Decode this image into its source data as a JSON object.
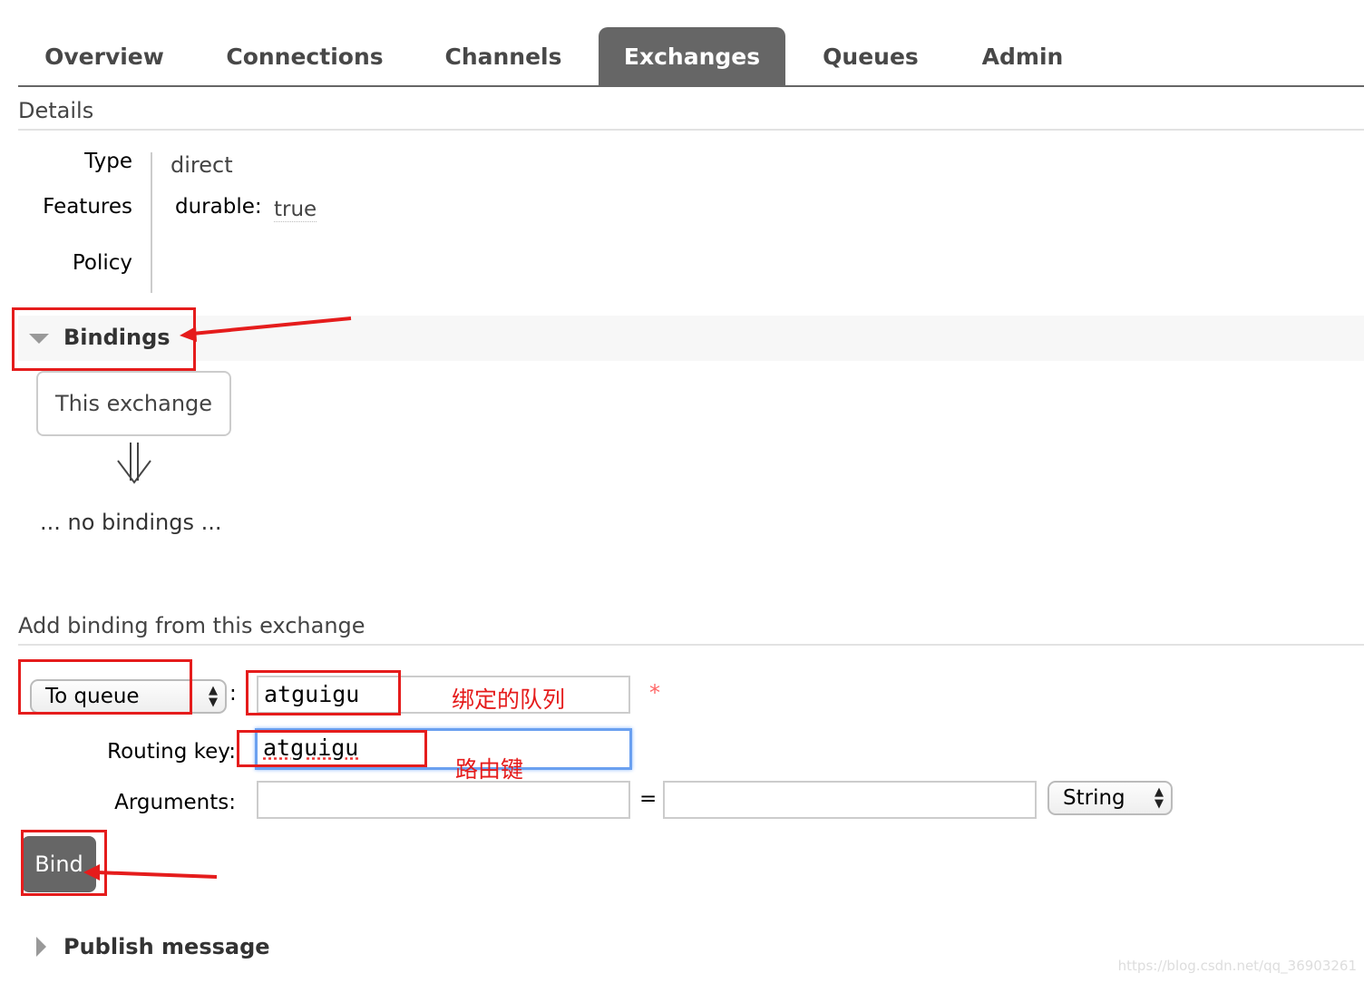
{
  "nav": {
    "tabs": [
      {
        "label": "Overview",
        "active": false
      },
      {
        "label": "Connections",
        "active": false
      },
      {
        "label": "Channels",
        "active": false
      },
      {
        "label": "Exchanges",
        "active": true
      },
      {
        "label": "Queues",
        "active": false
      },
      {
        "label": "Admin",
        "active": false
      }
    ]
  },
  "details": {
    "heading": "Details",
    "type_label": "Type",
    "type_value": "direct",
    "features_label": "Features",
    "durable_label": "durable:",
    "durable_value": "true",
    "policy_label": "Policy"
  },
  "bindings": {
    "heading": "Bindings",
    "this_exchange": "This exchange",
    "arrow_icon": "double-down-arrow",
    "empty_text": "... no bindings ..."
  },
  "add_binding": {
    "heading": "Add binding from this exchange",
    "destination_type": "To queue",
    "colon": ":",
    "destination_value": "atguigu",
    "required_mark": "*",
    "routing_key_label": "Routing key:",
    "routing_key_value": "atguigu",
    "arguments_label": "Arguments:",
    "argument_key": "",
    "equals": "=",
    "argument_value": "",
    "argument_type": "String",
    "bind_label": "Bind"
  },
  "publish": {
    "heading": "Publish message"
  },
  "annotations": {
    "queue_note": "绑定的队列",
    "routing_note": "路由键",
    "color": "#e51c1c"
  },
  "watermark": "https://blog.csdn.net/qq_36903261"
}
